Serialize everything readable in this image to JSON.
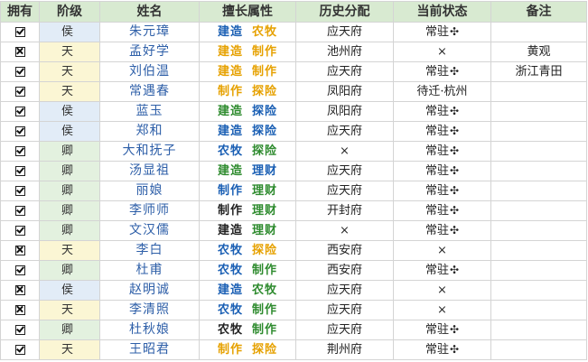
{
  "headers": {
    "owned": "拥有",
    "rank": "阶级",
    "name": "姓名",
    "skills": "擅长属性",
    "history": "历史分配",
    "state": "当前状态",
    "note": "备注"
  },
  "skill_colors": {
    "建造": "#1a5fb4",
    "农牧": "#2e8b2e",
    "制作": "#e6a100",
    "探险": "#e6a100",
    "理财": "#2e8b2e"
  },
  "rank_colors": {
    "侯": "#e2ecf7",
    "天": "#fbf6d4",
    "卿": "#e3f1df"
  },
  "rows": [
    {
      "owned": true,
      "rank": "侯",
      "name": "朱元璋",
      "skills": [
        {
          "t": "建造",
          "c": "#1a5fb4"
        },
        {
          "t": "农牧",
          "c": "#e6a100"
        }
      ],
      "history": "应天府",
      "state": "常驻",
      "pin": true,
      "note": ""
    },
    {
      "owned": false,
      "rank": "天",
      "name": "孟好学",
      "skills": [
        {
          "t": "建造",
          "c": "#e6a100"
        },
        {
          "t": "制作",
          "c": "#e6a100"
        }
      ],
      "history": "池州府",
      "state": "×",
      "pin": false,
      "note": "黄观"
    },
    {
      "owned": true,
      "rank": "天",
      "name": "刘伯温",
      "skills": [
        {
          "t": "建造",
          "c": "#e6a100"
        },
        {
          "t": "制作",
          "c": "#e6a100"
        }
      ],
      "history": "应天府",
      "state": "常驻",
      "pin": true,
      "note": "浙江青田"
    },
    {
      "owned": true,
      "rank": "天",
      "name": "常遇春",
      "skills": [
        {
          "t": "制作",
          "c": "#e6a100"
        },
        {
          "t": "探险",
          "c": "#e6a100"
        }
      ],
      "history": "凤阳府",
      "state": "待迁·杭州",
      "pin": false,
      "note": ""
    },
    {
      "owned": true,
      "rank": "侯",
      "name": "蓝玉",
      "skills": [
        {
          "t": "建造",
          "c": "#2e8b2e"
        },
        {
          "t": "探险",
          "c": "#1a5fb4"
        }
      ],
      "history": "凤阳府",
      "state": "常驻",
      "pin": true,
      "note": ""
    },
    {
      "owned": true,
      "rank": "侯",
      "name": "郑和",
      "skills": [
        {
          "t": "建造",
          "c": "#1a5fb4"
        },
        {
          "t": "探险",
          "c": "#1a5fb4"
        }
      ],
      "history": "应天府",
      "state": "常驻",
      "pin": true,
      "note": ""
    },
    {
      "owned": true,
      "rank": "卿",
      "name": "大和抚子",
      "skills": [
        {
          "t": "农牧",
          "c": "#1a5fb4"
        },
        {
          "t": "探险",
          "c": "#2e8b2e"
        }
      ],
      "history": "×",
      "state": "常驻",
      "pin": true,
      "note": ""
    },
    {
      "owned": true,
      "rank": "卿",
      "name": "汤显祖",
      "skills": [
        {
          "t": "建造",
          "c": "#2e8b2e"
        },
        {
          "t": "理财",
          "c": "#1a5fb4"
        }
      ],
      "history": "应天府",
      "state": "常驻",
      "pin": true,
      "note": ""
    },
    {
      "owned": true,
      "rank": "卿",
      "name": "丽娘",
      "skills": [
        {
          "t": "制作",
          "c": "#1a5fb4"
        },
        {
          "t": "理财",
          "c": "#2e8b2e"
        }
      ],
      "history": "应天府",
      "state": "常驻",
      "pin": true,
      "note": ""
    },
    {
      "owned": true,
      "rank": "卿",
      "name": "李师师",
      "skills": [
        {
          "t": "制作",
          "c": "#222222"
        },
        {
          "t": "理财",
          "c": "#2e8b2e"
        }
      ],
      "history": "开封府",
      "state": "常驻",
      "pin": true,
      "note": ""
    },
    {
      "owned": true,
      "rank": "卿",
      "name": "文汉儒",
      "skills": [
        {
          "t": "建造",
          "c": "#222222"
        },
        {
          "t": "理财",
          "c": "#2e8b2e"
        }
      ],
      "history": "×",
      "state": "常驻",
      "pin": true,
      "note": ""
    },
    {
      "owned": false,
      "rank": "天",
      "name": "李白",
      "skills": [
        {
          "t": "农牧",
          "c": "#1a5fb4"
        },
        {
          "t": "探险",
          "c": "#e6a100"
        }
      ],
      "history": "西安府",
      "state": "×",
      "pin": false,
      "note": ""
    },
    {
      "owned": true,
      "rank": "卿",
      "name": "杜甫",
      "skills": [
        {
          "t": "农牧",
          "c": "#1a5fb4"
        },
        {
          "t": "制作",
          "c": "#2e8b2e"
        }
      ],
      "history": "西安府",
      "state": "常驻",
      "pin": true,
      "note": ""
    },
    {
      "owned": false,
      "rank": "侯",
      "name": "赵明诚",
      "skills": [
        {
          "t": "建造",
          "c": "#1a5fb4"
        },
        {
          "t": "农牧",
          "c": "#2e8b2e"
        }
      ],
      "history": "应天府",
      "state": "×",
      "pin": false,
      "note": ""
    },
    {
      "owned": false,
      "rank": "天",
      "name": "李清照",
      "skills": [
        {
          "t": "农牧",
          "c": "#1a5fb4"
        },
        {
          "t": "制作",
          "c": "#2e8b2e"
        }
      ],
      "history": "应天府",
      "state": "×",
      "pin": false,
      "note": ""
    },
    {
      "owned": true,
      "rank": "卿",
      "name": "杜秋娘",
      "skills": [
        {
          "t": "农牧",
          "c": "#222222"
        },
        {
          "t": "制作",
          "c": "#2e8b2e"
        }
      ],
      "history": "应天府",
      "state": "常驻",
      "pin": true,
      "note": ""
    },
    {
      "owned": true,
      "rank": "天",
      "name": "王昭君",
      "skills": [
        {
          "t": "制作",
          "c": "#e6a100"
        },
        {
          "t": "探险",
          "c": "#e6a100"
        }
      ],
      "history": "荆州府",
      "state": "常驻",
      "pin": true,
      "note": ""
    }
  ],
  "pin_glyph": "✣",
  "icons": {
    "checked": "checkbox-checked-icon",
    "unchecked": "checkbox-x-icon"
  }
}
